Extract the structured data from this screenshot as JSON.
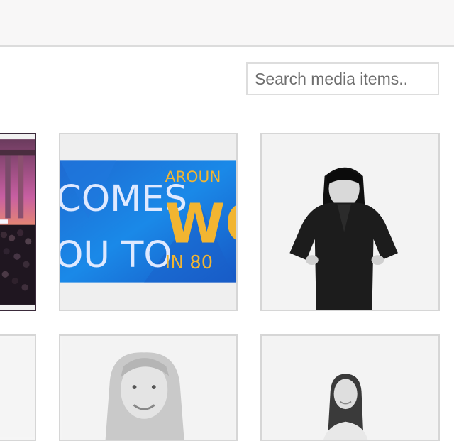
{
  "toolbar": {
    "search_placeholder": "Search media items.."
  },
  "media": {
    "banner": {
      "text_line1": "COMES",
      "text_line2": "OU TO",
      "text_right1": "AROUN",
      "text_right2": "WO",
      "text_right3": "IN 80"
    },
    "items": [
      {
        "name": "event-photo"
      },
      {
        "name": "banner-image"
      },
      {
        "name": "portrait-woman-dark-hair"
      },
      {
        "name": "partial-tile"
      },
      {
        "name": "portrait-woman-blonde"
      },
      {
        "name": "portrait-woman-brunette"
      }
    ]
  },
  "colors": {
    "banner_blue": "#1f6fd6",
    "banner_gold": "#f2b531",
    "border": "#d6d6d6"
  }
}
